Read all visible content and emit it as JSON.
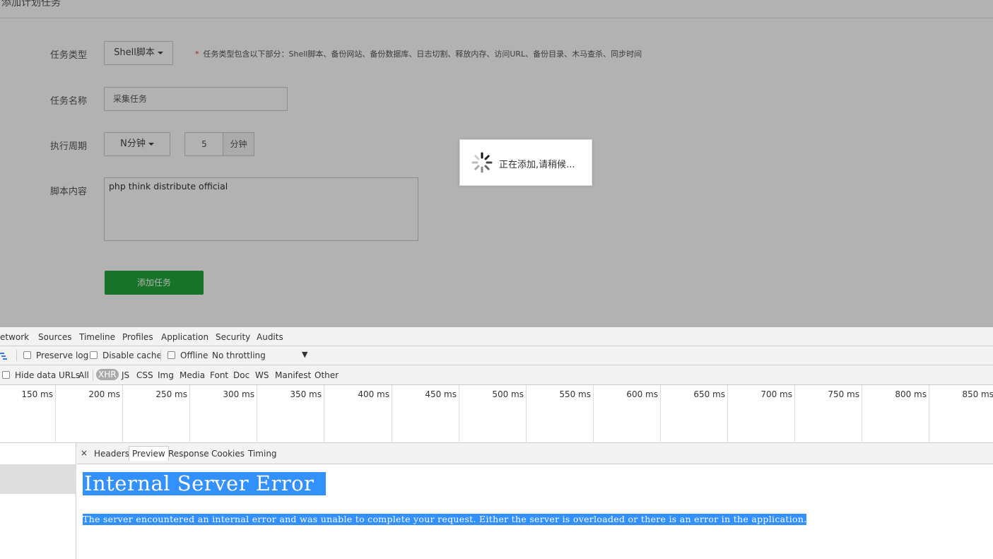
{
  "page": {
    "title": "添加计划任务",
    "form": {
      "task_type_label": "任务类型",
      "task_type_value": "Shell脚本",
      "task_type_hint_star": "*",
      "task_type_hint": "任务类型包含以下部分：Shell脚本、备份网站、备份数据库、日志切割、释放内存、访问URL、备份目录、木马查杀、同步时间",
      "task_name_label": "任务名称",
      "task_name_value": "采集任务",
      "cycle_label": "执行周期",
      "cycle_value": "N分钟",
      "cycle_minutes": "5",
      "cycle_unit": "分钟",
      "script_label": "脚本内容",
      "script_value": "php think distribute official",
      "submit_label": "添加任务"
    },
    "loading": {
      "text": "正在添加,请稍候..."
    }
  },
  "devtools": {
    "tabs": [
      "etwork",
      "Sources",
      "Timeline",
      "Profiles",
      "Application",
      "Security",
      "Audits"
    ],
    "toolbar": {
      "preserve_log": "Preserve log",
      "disable_cache": "Disable cache",
      "offline": "Offline",
      "throttling": "No throttling"
    },
    "filters": {
      "hide_data_urls": "Hide data URLs",
      "types": [
        "All",
        "XHR",
        "JS",
        "CSS",
        "Img",
        "Media",
        "Font",
        "Doc",
        "WS",
        "Manifest",
        "Other"
      ],
      "selected": "XHR"
    },
    "timeline_labels": [
      "150 ms",
      "200 ms",
      "250 ms",
      "300 ms",
      "350 ms",
      "400 ms",
      "450 ms",
      "500 ms",
      "550 ms",
      "600 ms",
      "650 ms",
      "700 ms",
      "750 ms",
      "800 ms",
      "850 ms"
    ],
    "detail": {
      "close": "×",
      "tabs": [
        "Headers",
        "Preview",
        "Response",
        "Cookies",
        "Timing"
      ],
      "active_tab": "Preview",
      "error_title": "Internal Server Error",
      "error_text": "The server encountered an internal error and was unable to complete your request. Either the server is overloaded or there is an error in the application."
    }
  }
}
